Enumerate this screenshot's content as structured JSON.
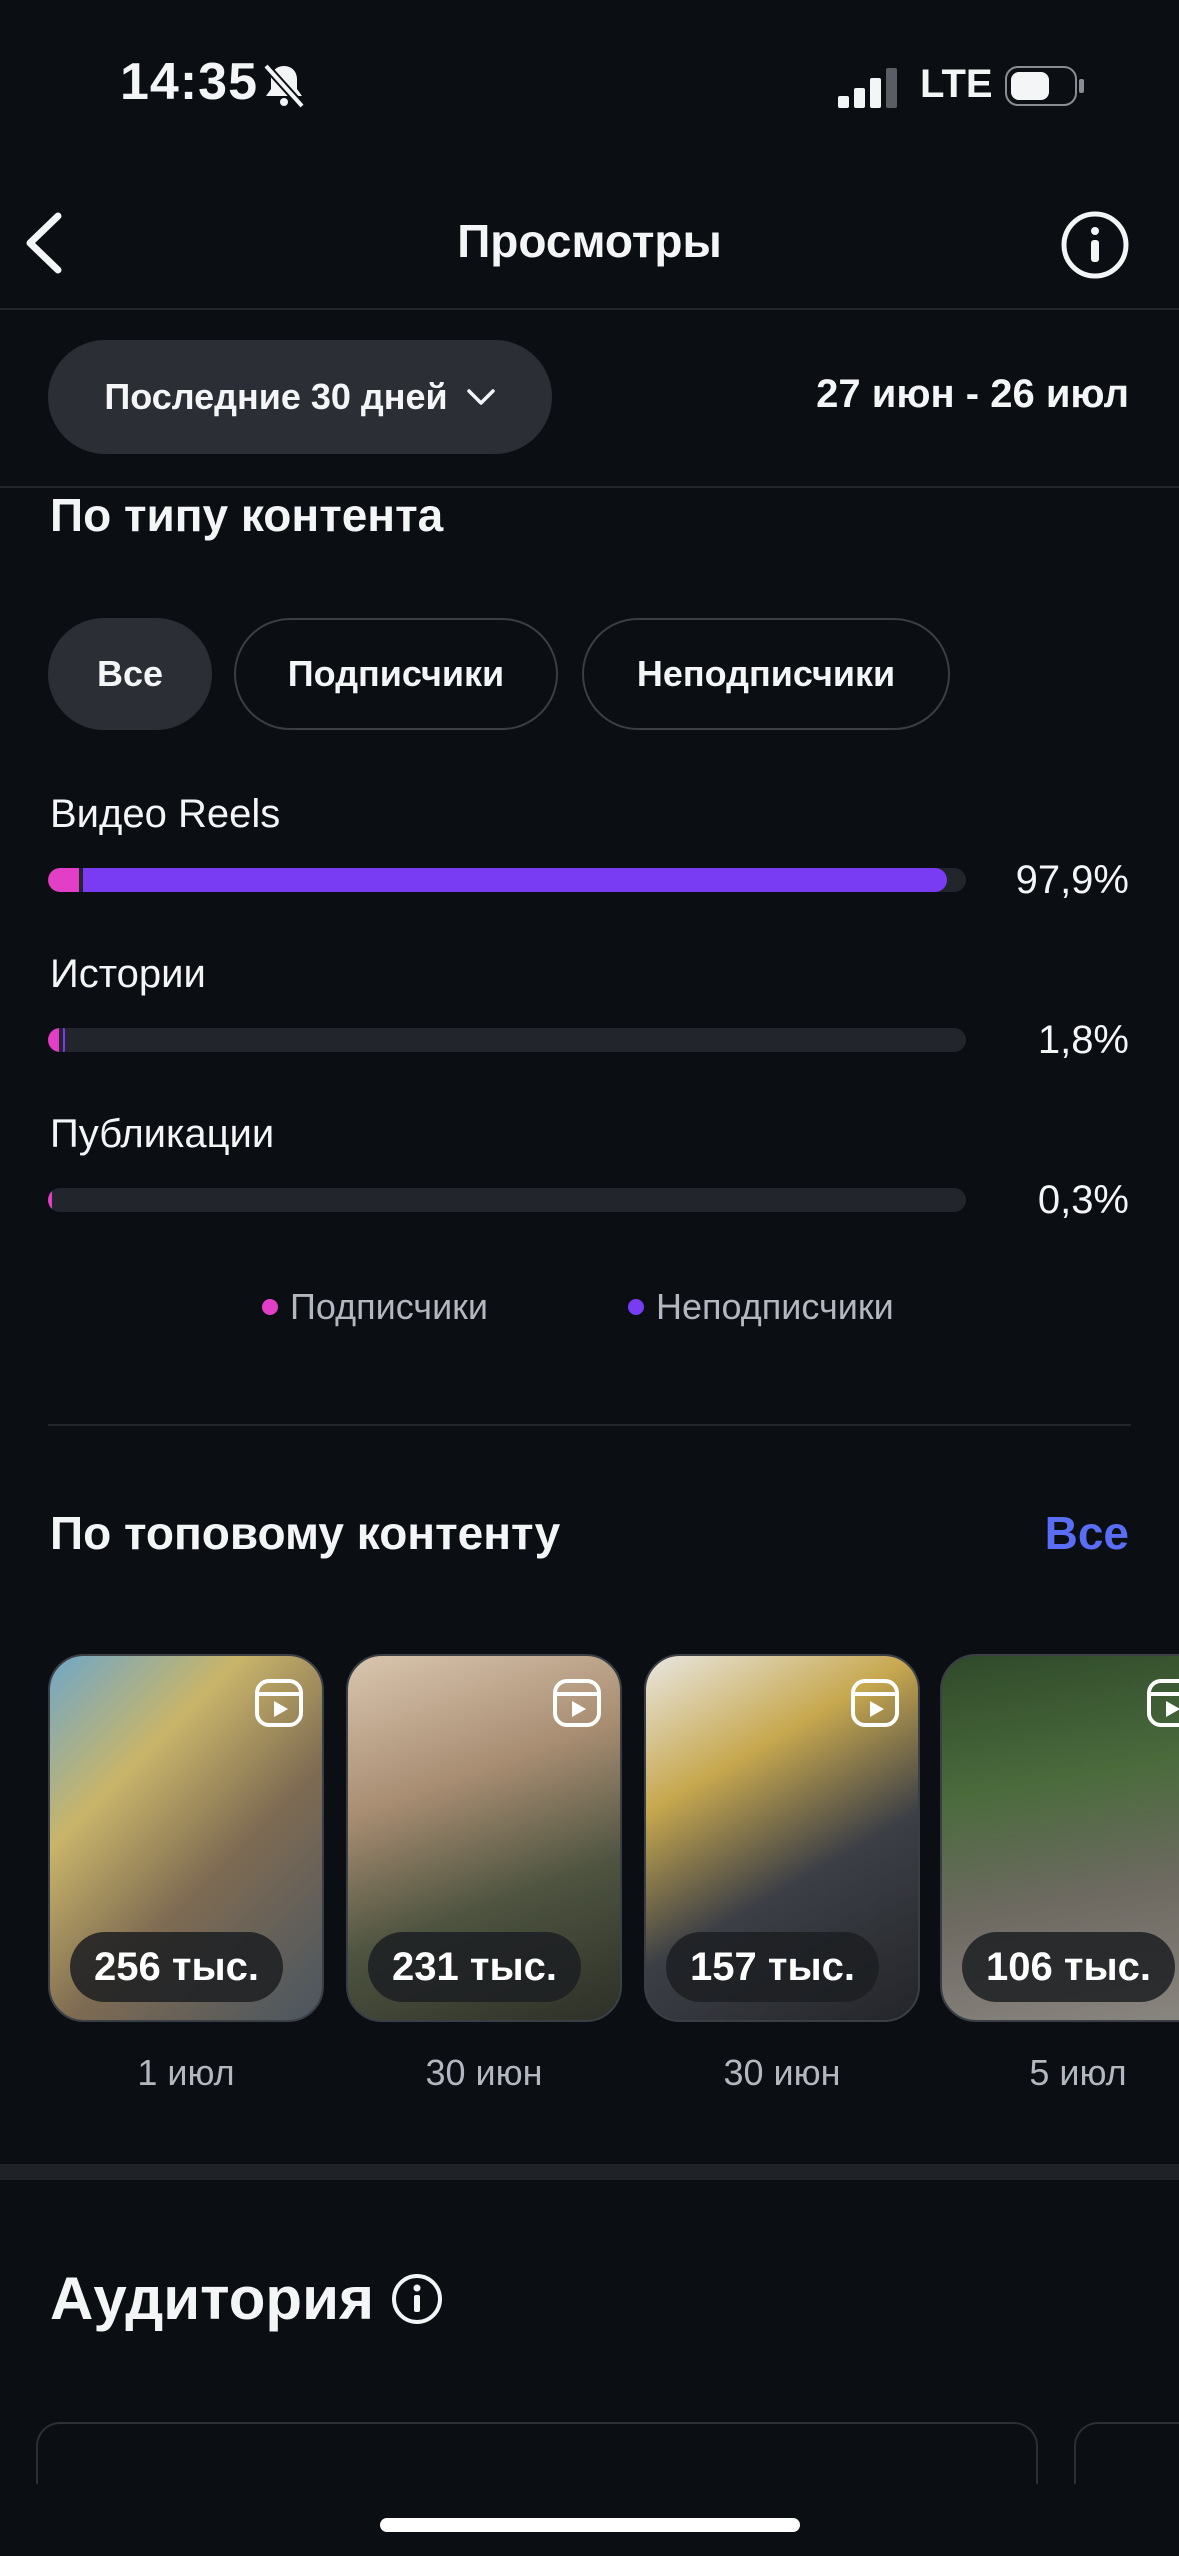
{
  "status_bar": {
    "time": "14:35",
    "network": "LTE"
  },
  "header": {
    "title": "Просмотры"
  },
  "filter": {
    "period": "Последние 30 дней",
    "range": "27 июн - 26 июл"
  },
  "content_type": {
    "title": "По типу контента",
    "tabs": [
      {
        "label": "Все",
        "active": true
      },
      {
        "label": "Подписчики",
        "active": false
      },
      {
        "label": "Неподписчики",
        "active": false
      }
    ],
    "bars": [
      {
        "label": "Видео Reels",
        "percent_text": "97,9%",
        "value": 97.9,
        "followers_share": 3.4
      },
      {
        "label": "Истории",
        "percent_text": "1,8%",
        "value": 1.8,
        "followers_share": 1.2
      },
      {
        "label": "Публикации",
        "percent_text": "0,3%",
        "value": 0.3,
        "followers_share": 0.3
      }
    ],
    "legend": [
      {
        "label": "Подписчики",
        "color": "#e23fc6"
      },
      {
        "label": "Неподписчики",
        "color": "#7a3cf2"
      }
    ]
  },
  "top_content": {
    "title": "По топовому контенту",
    "see_all": "Все",
    "items": [
      {
        "views": "256 тыс.",
        "date": "1 июл"
      },
      {
        "views": "231 тыс.",
        "date": "30 июн"
      },
      {
        "views": "157 тыс.",
        "date": "30 июн"
      },
      {
        "views": "106 тыс.",
        "date": "5 июл"
      }
    ]
  },
  "audience": {
    "title": "Аудитория"
  },
  "colors": {
    "accent": "#5a6df5",
    "followers": "#e23fc6",
    "non_followers": "#7a3cf2",
    "background": "#0b0e13"
  }
}
